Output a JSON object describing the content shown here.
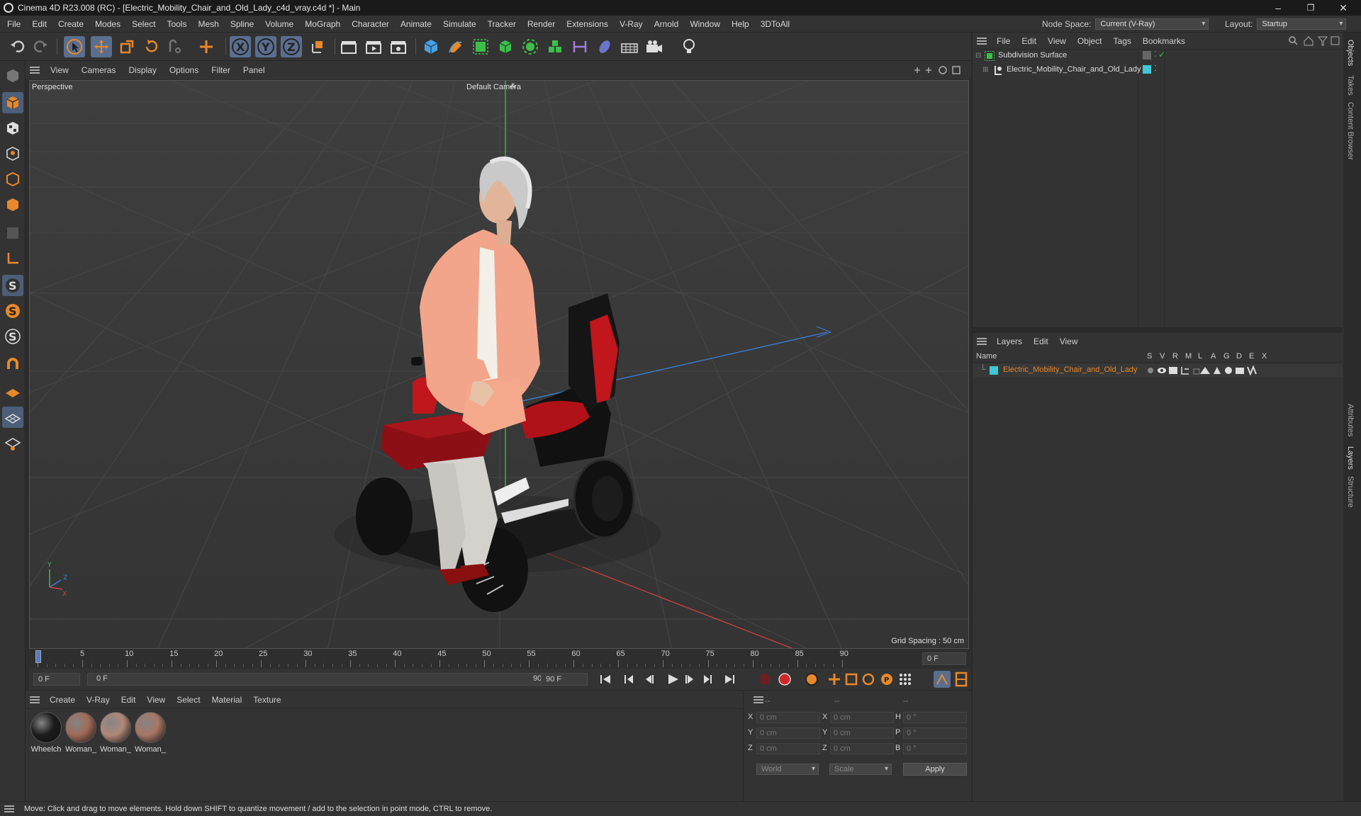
{
  "window": {
    "title": "Cinema 4D R23.008 (RC) - [Electric_Mobility_Chair_and_Old_Lady_c4d_vray.c4d *] - Main",
    "minimize": "–",
    "restore": "❐",
    "close": "✕"
  },
  "menu": {
    "items": [
      "File",
      "Edit",
      "Create",
      "Modes",
      "Select",
      "Tools",
      "Mesh",
      "Spline",
      "Volume",
      "MoGraph",
      "Character",
      "Animate",
      "Simulate",
      "Tracker",
      "Render",
      "Extensions",
      "V-Ray",
      "Arnold",
      "Window",
      "Help",
      "3DToAll"
    ],
    "node_space_label": "Node Space:",
    "node_space_value": "Current (V-Ray)",
    "layout_label": "Layout:",
    "layout_value": "Startup"
  },
  "viewport": {
    "menu": [
      "View",
      "Cameras",
      "Display",
      "Options",
      "Filter",
      "Panel"
    ],
    "view_name": "Perspective",
    "camera": "Default Camera",
    "grid_spacing": "Grid Spacing : 50 cm"
  },
  "timeline": {
    "ticks": [
      "0",
      "5",
      "10",
      "15",
      "20",
      "25",
      "30",
      "35",
      "40",
      "45",
      "50",
      "55",
      "60",
      "65",
      "70",
      "75",
      "80",
      "85",
      "90"
    ],
    "current_frame": "0 F",
    "start_field": "0 F",
    "range_start": "0 F",
    "range_end": "90 F",
    "end_field": "90 F"
  },
  "materials": {
    "menu": [
      "Create",
      "V-Ray",
      "Edit",
      "View",
      "Select",
      "Material",
      "Texture"
    ],
    "items": [
      {
        "label": "Wheelch",
        "color": "#1c1c1c"
      },
      {
        "label": "Woman_",
        "color": "#a06b58"
      },
      {
        "label": "Woman_",
        "color": "#b08878"
      },
      {
        "label": "Woman_",
        "color": "#a87565"
      }
    ]
  },
  "coords": {
    "headers": [
      "--",
      "--",
      "--"
    ],
    "rows": [
      {
        "a": "X",
        "av": "0 cm",
        "b": "X",
        "bv": "0 cm",
        "c": "H",
        "cv": "0 °"
      },
      {
        "a": "Y",
        "av": "0 cm",
        "b": "Y",
        "bv": "0 cm",
        "c": "P",
        "cv": "0 °"
      },
      {
        "a": "Z",
        "av": "0 cm",
        "b": "Z",
        "bv": "0 cm",
        "c": "B",
        "cv": "0 °"
      }
    ],
    "space": "World",
    "mode": "Scale",
    "apply": "Apply"
  },
  "objects": {
    "menu": [
      "File",
      "Edit",
      "View",
      "Object",
      "Tags",
      "Bookmarks"
    ],
    "items": [
      {
        "name": "Subdivision Surface"
      },
      {
        "name": "Electric_Mobility_Chair_and_Old_Lady"
      }
    ]
  },
  "layers": {
    "menu": [
      "Layers",
      "Edit",
      "View"
    ],
    "name_header": "Name",
    "flags": [
      "S",
      "V",
      "R",
      "M",
      "L",
      "A",
      "G",
      "D",
      "E",
      "X"
    ],
    "items": [
      {
        "name": "Electric_Mobility_Chair_and_Old_Lady",
        "color": "#3ec8d8"
      }
    ]
  },
  "side_tabs": [
    "Objects",
    "Takes",
    "Content Browser",
    "Attributes",
    "Layers",
    "Structure"
  ],
  "status": "Move: Click and drag to move elements. Hold down SHIFT to quantize movement / add to the selection in point mode, CTRL to remove.",
  "accent": "#e8882a"
}
